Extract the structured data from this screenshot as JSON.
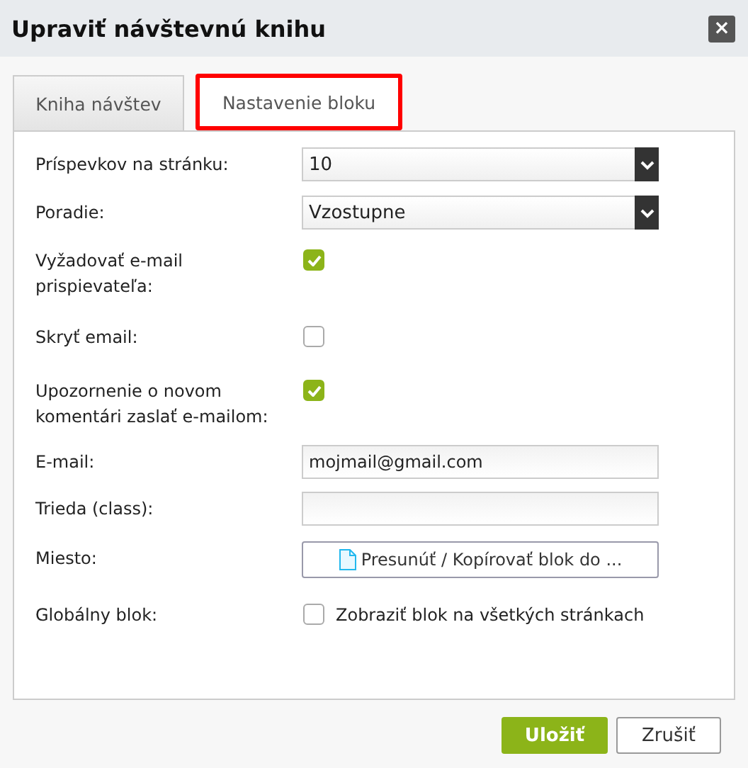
{
  "window": {
    "title": "Upraviť návštevnú knihu",
    "close": "×"
  },
  "tabs": [
    {
      "label": "Kniha návštev",
      "selected": false
    },
    {
      "label": "Nastavenie bloku",
      "selected": true
    }
  ],
  "rows": [
    {
      "kind": "select",
      "label": "Príspevkov na stránku:",
      "value": "10"
    },
    {
      "kind": "select",
      "label": "Poradie:",
      "value": "Vzostupne"
    },
    {
      "kind": "checkbox",
      "label": "Vyžadovať e-mail prispievateľa:",
      "checked": true
    },
    {
      "kind": "checkbox",
      "label": "Skryť email:",
      "checked": false
    },
    {
      "kind": "checkbox",
      "label": "Upozornenie o novom komentári zaslať e-mailom:",
      "checked": true
    },
    {
      "kind": "text",
      "label": "E-mail:",
      "value": "mojmail@gmail.com"
    },
    {
      "kind": "text",
      "label": "Trieda (class):"
    },
    {
      "kind": "button",
      "label": "Miesto:",
      "value": "Presunúť / Kopírovať blok do ..."
    },
    {
      "kind": "checkbox",
      "label": "Globálny blok:",
      "checked": false,
      "text": "Zobraziť blok na všetkých stránkach"
    }
  ],
  "buttons": [
    {
      "label": "Uložiť",
      "kind": "primary"
    },
    {
      "label": "Zrušiť",
      "kind": "secondary"
    }
  ]
}
